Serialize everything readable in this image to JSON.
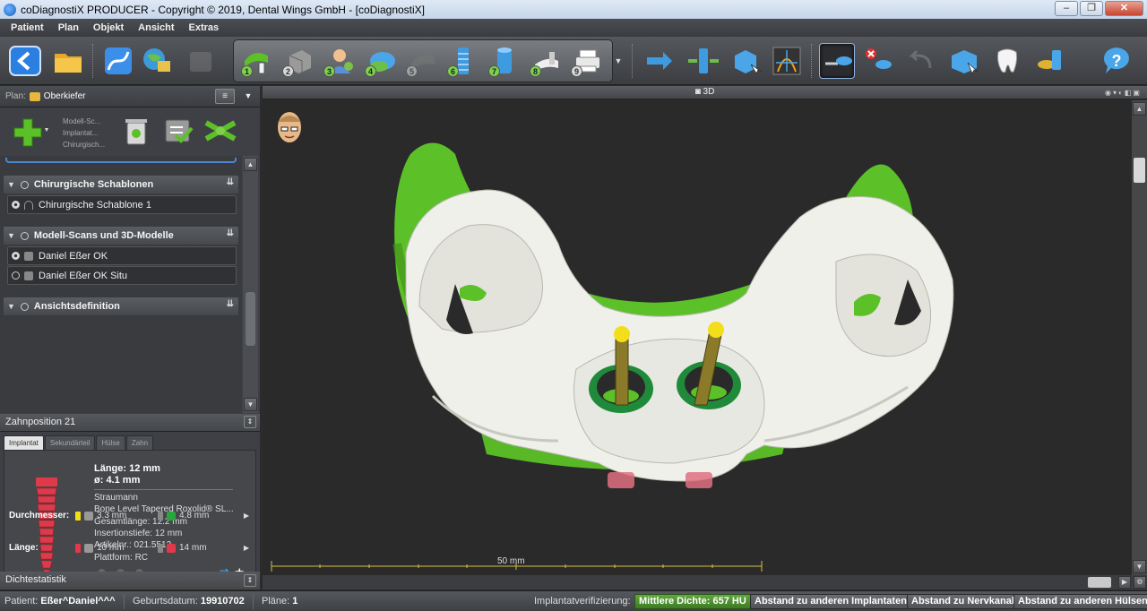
{
  "window": {
    "title": "coDiagnostiX PRODUCER - Copyright © 2019, Dental Wings GmbH - [coDiagnostiX]"
  },
  "menu": [
    "Patient",
    "Plan",
    "Objekt",
    "Ansicht",
    "Extras"
  ],
  "workflow_steps": [
    "1",
    "2",
    "3",
    "4",
    "5",
    "6",
    "7",
    "8",
    "9"
  ],
  "plan": {
    "label": "Plan:",
    "name": "Oberkiefer",
    "small_labels": [
      "Modell-Sc...",
      "Implantat...",
      "Chirurgisch..."
    ]
  },
  "tree": {
    "sections": [
      {
        "title": "Chirurgische Schablonen",
        "rows": [
          "Chirurgische Schablone 1"
        ]
      },
      {
        "title": "Modell-Scans und 3D-Modelle",
        "rows": [
          "Daniel Eßer OK",
          "Daniel Eßer OK Situ"
        ]
      },
      {
        "title": "Ansichtsdefinition",
        "rows": []
      }
    ]
  },
  "position": {
    "label": "Zahnposition 21"
  },
  "tabs": [
    "Implantat",
    "Sekundärteil",
    "Hülse",
    "Zahn"
  ],
  "implant": {
    "length": "Länge: 12 mm",
    "diameter": "ø: 4.1 mm",
    "manufacturer": "Straumann",
    "model": "Bone Level Tapered Roxolid® SL...",
    "total_length": "Gesamtlänge: 12.2 mm",
    "insertion_depth": "Insertionstiefe: 12 mm",
    "article": "Artikelnr.: 021.5512",
    "platform": "Plattform: RC"
  },
  "diameter_row": {
    "label": "Durchmesser:",
    "opt1": "3.3 mm",
    "opt2": "4.8 mm"
  },
  "length_row": {
    "label": "Länge:",
    "opt1": "10 mm",
    "opt2": "14 mm"
  },
  "density": {
    "label": "Dichtestatistik"
  },
  "view": {
    "title": "3D",
    "scale_label": "50 mm"
  },
  "status": {
    "patient": "Patient: ",
    "patient_value": "Eßer^Daniel^^^",
    "dob": "Geburtsdatum: ",
    "dob_value": "19910702",
    "plans": "Pläne: ",
    "plans_value": "1",
    "verification": "Implantatverifizierung:",
    "density_button": "Mittlere Dichte: 657 HU",
    "btn_implants": "Abstand zu anderen Implantaten",
    "btn_nerve": "Abstand zu Nervkanal",
    "btn_sleeves": "Abstand zu anderen Hülsen"
  },
  "colors": {
    "model_green": "#5cc128",
    "guide_white": "#f0f0ea",
    "implant_red": "#e03a4a",
    "pin_gold": "#8a7a2a",
    "pin_tip": "#f2de1a",
    "sleeve_green": "#1f8a3a"
  }
}
